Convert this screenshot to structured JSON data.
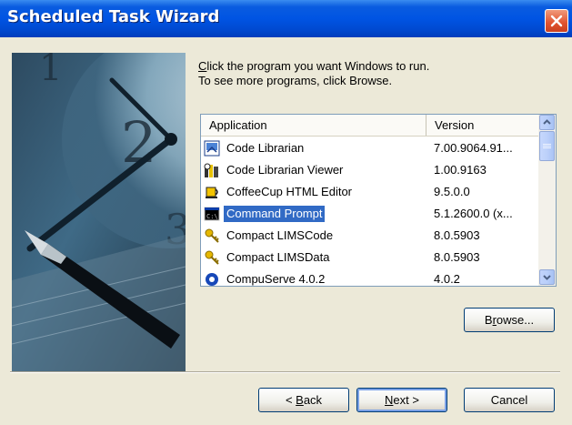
{
  "window": {
    "title": "Scheduled Task Wizard"
  },
  "instructions": {
    "line1_mnemonic": "C",
    "line1_rest": "lick the program you want Windows to run.",
    "line2": "To see more programs, click Browse."
  },
  "list": {
    "columns": [
      "Application",
      "Version"
    ],
    "rows": [
      {
        "name": "Code Librarian",
        "version": "7.00.9064.91...",
        "icon": "code-librarian-icon"
      },
      {
        "name": "Code Librarian Viewer",
        "version": "1.00.9163",
        "icon": "code-librarian-viewer-icon"
      },
      {
        "name": "CoffeeCup HTML Editor",
        "version": "9.5.0.0",
        "icon": "coffeecup-icon"
      },
      {
        "name": "Command Prompt",
        "version": "5.1.2600.0 (x...",
        "icon": "command-prompt-icon",
        "selected": true
      },
      {
        "name": "Compact LIMSCode",
        "version": "8.0.5903",
        "icon": "keys-icon"
      },
      {
        "name": "Compact LIMSData",
        "version": "8.0.5903",
        "icon": "keys-icon"
      },
      {
        "name": "CompuServe 4.0.2",
        "version": "4.0.2",
        "icon": "compuserve-icon"
      }
    ]
  },
  "buttons": {
    "browse": {
      "mnemonic": "r",
      "pre": "B",
      "post": "owse..."
    },
    "back": {
      "pre": "< ",
      "mnemonic": "B",
      "post": "ack"
    },
    "next": {
      "mnemonic": "N",
      "post": "ext >"
    },
    "cancel": {
      "label": "Cancel"
    }
  },
  "colors": {
    "titlebar": "#0054E3",
    "selection": "#316AC5",
    "dialog_bg": "#ECE9D8"
  }
}
